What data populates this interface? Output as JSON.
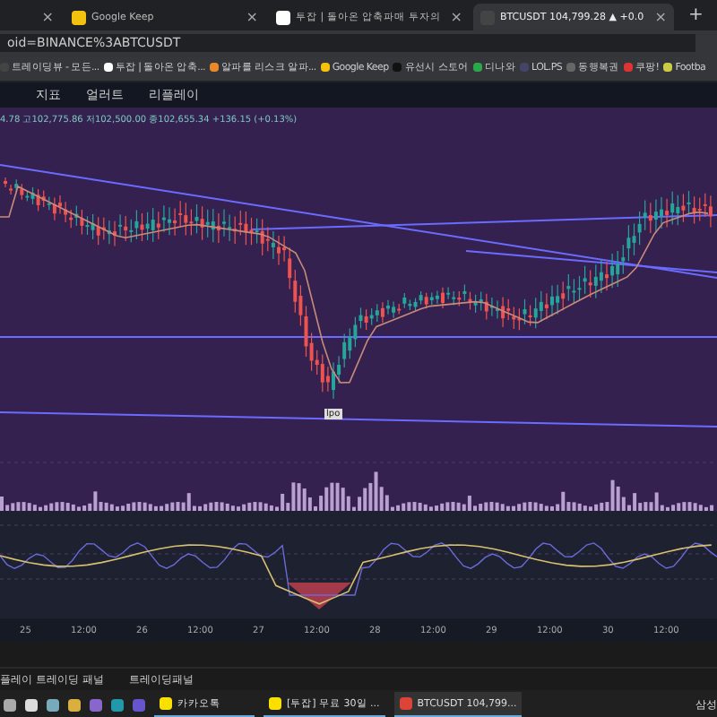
{
  "browser": {
    "tabs": [
      {
        "close": "×",
        "selected": false
      },
      {
        "title": "Google Keep",
        "close": "×",
        "selected": false
      },
      {
        "title": "투잡 | 돌아온 압축파매 투자의",
        "close": "×",
        "selected": false
      },
      {
        "title": "BTCUSDT 104,799.28 ▲ +0.0",
        "close": "×",
        "selected": true
      }
    ],
    "new_tab": "+",
    "address": "oid=BINANCE%3ABTCUSDT",
    "bookmarks": [
      "트레이딩뷰 - 모든...",
      "투잡 | 돌아온 압축...",
      "알파를 리스크 알파...",
      "Google Keep",
      "유선시 스토어",
      "디나와",
      "LOL.PS",
      "동행복권",
      "쿠팡!",
      "Footba"
    ]
  },
  "toolbar": {
    "items": [
      "지표",
      "얼러트",
      "리플레이"
    ]
  },
  "legend": "4.78 고102,775.86 저102,500.00 종102,655.34 +136.15 (+0.13%)",
  "chart_label": "lpo",
  "time_axis": [
    "25",
    "12:00",
    "26",
    "12:00",
    "27",
    "12:00",
    "28",
    "12:00",
    "29",
    "12:00",
    "30",
    "12:00"
  ],
  "panel_tabs": [
    "플레이 트레이딩 패널",
    "트레이딩패널"
  ],
  "taskbar": {
    "windows": [
      {
        "title": "카카오톡",
        "selected": false
      },
      {
        "title": "[투잡] 무료 30일 ...",
        "selected": false
      },
      {
        "title": "BTCUSDT 104,799...",
        "selected": true
      }
    ],
    "tray": "삼성"
  }
}
